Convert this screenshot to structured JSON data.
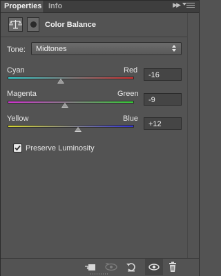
{
  "tabs": [
    {
      "label": "Properties",
      "active": true
    },
    {
      "label": "Info",
      "active": false
    }
  ],
  "tab_close_symbol": "×",
  "panel_title": "Color Balance",
  "tone": {
    "label": "Tone:",
    "selected": "Midtones"
  },
  "sliders": [
    {
      "left": "Cyan",
      "right": "Red",
      "value": "-16",
      "position": -16
    },
    {
      "left": "Magenta",
      "right": "Green",
      "value": "-9",
      "position": -9
    },
    {
      "left": "Yellow",
      "right": "Blue",
      "value": "+12",
      "position": 12
    }
  ],
  "slider_range": [
    -100,
    100
  ],
  "preserve_luminosity": {
    "label": "Preserve Luminosity",
    "checked": true
  },
  "icons": {
    "adjustment": "color-balance-scale-icon",
    "mask": "layer-mask-icon",
    "collapse": "double-chevron-right-icon",
    "menu": "panel-menu-icon",
    "footer": [
      "clip-to-layer-icon",
      "view-previous-state-icon",
      "reset-icon",
      "visibility-eye-icon",
      "trash-icon"
    ]
  },
  "colors": {
    "panel_bg": "#535353",
    "tab_bar_bg": "#3e3e3e",
    "cyan": "#34d6d6",
    "red": "#d83232",
    "magenta": "#d634d6",
    "green": "#36d236",
    "yellow": "#d8d834",
    "blue": "#3434d6"
  }
}
